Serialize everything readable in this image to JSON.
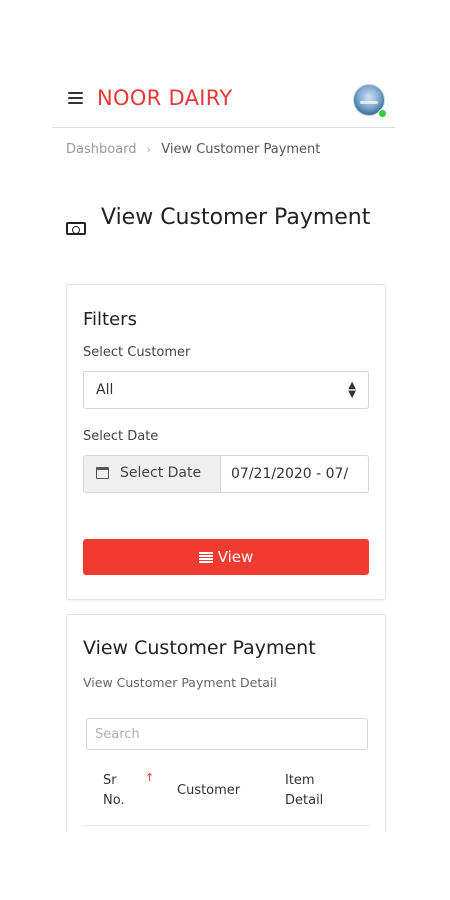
{
  "header": {
    "brand": "NOOR DAIRY",
    "menu_icon": "hamburger-menu-icon",
    "avatar_status": "online",
    "brand_color": "#e53935"
  },
  "breadcrumb": {
    "items": [
      "Dashboard",
      "View Customer Payment"
    ],
    "separator": "›"
  },
  "page": {
    "title": "View Customer Payment",
    "title_icon": "money-bill-icon"
  },
  "filters": {
    "title": "Filters",
    "customer_label": "Select Customer",
    "customer_value": "All",
    "date_label": "Select Date",
    "date_addon": "Select Date",
    "date_value": "07/21/2020 - 07/",
    "view_button": "View",
    "view_button_color": "#f23b30"
  },
  "payments": {
    "title": "View Customer Payment",
    "subtitle": "View Customer Payment Detail",
    "search_placeholder": "Search",
    "columns": [
      "Sr No.",
      "Customer",
      "Item Detail"
    ],
    "sort_indicator": "↑"
  }
}
